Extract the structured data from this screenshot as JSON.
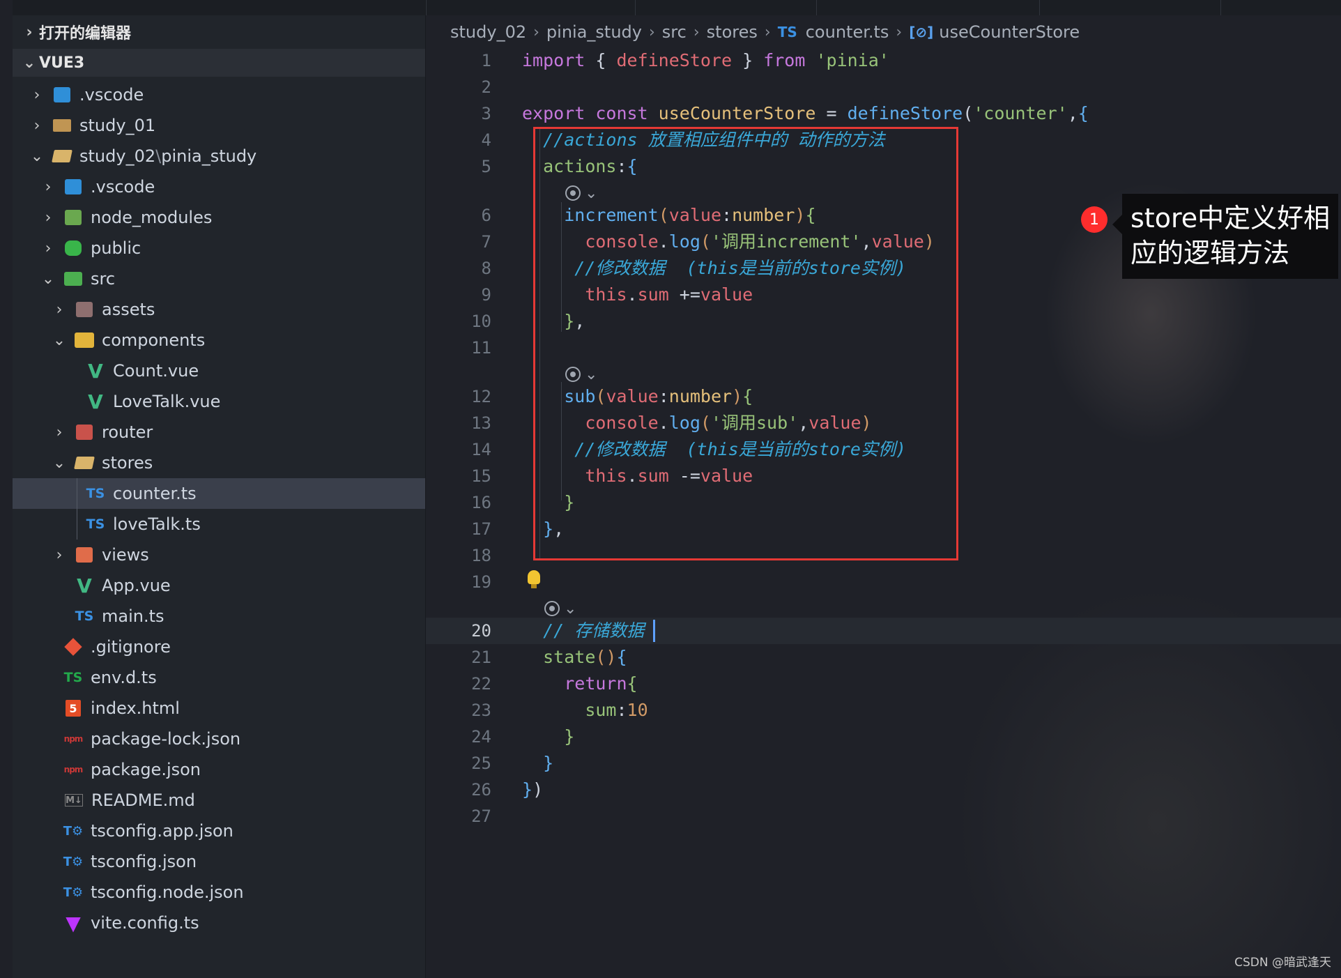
{
  "explorer": {
    "open_editors_label": "打开的编辑器",
    "workspace_label": "VUE3",
    "tree": [
      {
        "label": ".vscode",
        "icon": "vscode-folder-icon",
        "indent": 0,
        "chevron": "›"
      },
      {
        "label": "study_01",
        "icon": "folder-icon",
        "indent": 0,
        "chevron": "›"
      },
      {
        "label": "study_02",
        "label2": "pinia_study",
        "icon": "folder-open-icon",
        "indent": 0,
        "chevron": "⌄"
      },
      {
        "label": ".vscode",
        "icon": "vscode-folder-icon",
        "indent": 1,
        "chevron": "›"
      },
      {
        "label": "node_modules",
        "icon": "node-folder-icon",
        "indent": 1,
        "chevron": "›"
      },
      {
        "label": "public",
        "icon": "public-folder-icon",
        "indent": 1,
        "chevron": "›"
      },
      {
        "label": "src",
        "icon": "src-folder-icon",
        "indent": 1,
        "chevron": "⌄"
      },
      {
        "label": "assets",
        "icon": "assets-folder-icon",
        "indent": 2,
        "chevron": "›"
      },
      {
        "label": "components",
        "icon": "components-folder-icon",
        "indent": 2,
        "chevron": "⌄"
      },
      {
        "label": "Count.vue",
        "icon": "vue-file-icon",
        "indent": 3,
        "chevron": ""
      },
      {
        "label": "LoveTalk.vue",
        "icon": "vue-file-icon",
        "indent": 3,
        "chevron": ""
      },
      {
        "label": "router",
        "icon": "router-folder-icon",
        "indent": 2,
        "chevron": "›"
      },
      {
        "label": "stores",
        "icon": "folder-open-icon",
        "indent": 2,
        "chevron": "⌄"
      },
      {
        "label": "counter.ts",
        "icon": "typescript-file-icon",
        "indent": 3,
        "chevron": "",
        "selected": true
      },
      {
        "label": "loveTalk.ts",
        "icon": "typescript-file-icon",
        "indent": 3,
        "chevron": ""
      },
      {
        "label": "views",
        "icon": "views-folder-icon",
        "indent": 2,
        "chevron": "›"
      },
      {
        "label": "App.vue",
        "icon": "vue-file-icon",
        "indent": 2,
        "chevron": ""
      },
      {
        "label": "main.ts",
        "icon": "typescript-file-icon",
        "indent": 2,
        "chevron": ""
      },
      {
        "label": ".gitignore",
        "icon": "git-file-icon",
        "indent": 1,
        "chevron": ""
      },
      {
        "label": "env.d.ts",
        "icon": "typescript-def-file-icon",
        "indent": 1,
        "chevron": ""
      },
      {
        "label": "index.html",
        "icon": "html-file-icon",
        "indent": 1,
        "chevron": ""
      },
      {
        "label": "package-lock.json",
        "icon": "npm-file-icon",
        "indent": 1,
        "chevron": ""
      },
      {
        "label": "package.json",
        "icon": "npm-file-icon",
        "indent": 1,
        "chevron": ""
      },
      {
        "label": "README.md",
        "icon": "markdown-file-icon",
        "indent": 1,
        "chevron": ""
      },
      {
        "label": "tsconfig.app.json",
        "icon": "tsconfig-file-icon",
        "indent": 1,
        "chevron": ""
      },
      {
        "label": "tsconfig.json",
        "icon": "tsconfig-file-icon",
        "indent": 1,
        "chevron": ""
      },
      {
        "label": "tsconfig.node.json",
        "icon": "tsconfig-file-icon",
        "indent": 1,
        "chevron": ""
      },
      {
        "label": "vite.config.ts",
        "icon": "vite-file-icon",
        "indent": 1,
        "chevron": ""
      }
    ]
  },
  "breadcrumb": {
    "items": [
      "study_02",
      "pinia_study",
      "src",
      "stores"
    ],
    "file_badge": "TS",
    "file": "counter.ts",
    "symbol_icon": "[⊘]",
    "symbol": "useCounterStore"
  },
  "code": {
    "lines": [
      {
        "n": "1",
        "tokens": [
          [
            "k",
            "import "
          ],
          [
            "p",
            "{ "
          ],
          [
            "v",
            "defineStore"
          ],
          [
            "p",
            " } "
          ],
          [
            "k",
            "from "
          ],
          [
            "s",
            "'pinia'"
          ]
        ]
      },
      {
        "n": "2",
        "tokens": []
      },
      {
        "n": "3",
        "tokens": [
          [
            "k",
            "export "
          ],
          [
            "k",
            "const "
          ],
          [
            "fn",
            "useCounterStore"
          ],
          [
            "p",
            " = "
          ],
          [
            "f",
            "defineStore"
          ],
          [
            "p",
            "("
          ],
          [
            "s",
            "'counter'"
          ],
          [
            "p",
            ","
          ],
          [
            "b2",
            "{"
          ]
        ]
      },
      {
        "n": "4",
        "tokens": [
          [
            "c",
            "  //actions 放置相应组件中的 动作的方法"
          ]
        ]
      },
      {
        "n": "5",
        "tokens": [
          [
            "p",
            "  "
          ],
          [
            "s",
            "actions"
          ],
          [
            "p",
            ":"
          ],
          [
            "b2",
            "{"
          ]
        ]
      },
      {
        "lens": true
      },
      {
        "n": "6",
        "tokens": [
          [
            "p",
            "    "
          ],
          [
            "f",
            "increment"
          ],
          [
            "b1",
            "("
          ],
          [
            "v",
            "value"
          ],
          [
            "p",
            ":"
          ],
          [
            "t",
            "number"
          ],
          [
            "b1",
            ")"
          ],
          [
            "b3",
            "{"
          ]
        ]
      },
      {
        "n": "7",
        "tokens": [
          [
            "p",
            "      "
          ],
          [
            "v",
            "console"
          ],
          [
            "p",
            "."
          ],
          [
            "f",
            "log"
          ],
          [
            "b1",
            "("
          ],
          [
            "s",
            "'调用increment'"
          ],
          [
            "p",
            ","
          ],
          [
            "v",
            "value"
          ],
          [
            "b1",
            ")"
          ]
        ]
      },
      {
        "n": "8",
        "tokens": [
          [
            "c",
            "     //修改数据  (this是当前的store实例)"
          ]
        ]
      },
      {
        "n": "9",
        "tokens": [
          [
            "p",
            "      "
          ],
          [
            "v",
            "this"
          ],
          [
            "p",
            "."
          ],
          [
            "v",
            "sum"
          ],
          [
            "p",
            " +="
          ],
          [
            "v",
            "value"
          ]
        ]
      },
      {
        "n": "10",
        "tokens": [
          [
            "p",
            "    "
          ],
          [
            "b3",
            "}"
          ],
          [
            "p",
            ","
          ]
        ]
      },
      {
        "n": "11",
        "tokens": []
      },
      {
        "lens": true
      },
      {
        "n": "12",
        "tokens": [
          [
            "p",
            "    "
          ],
          [
            "f",
            "sub"
          ],
          [
            "b1",
            "("
          ],
          [
            "v",
            "value"
          ],
          [
            "p",
            ":"
          ],
          [
            "t",
            "number"
          ],
          [
            "b1",
            ")"
          ],
          [
            "b3",
            "{"
          ]
        ]
      },
      {
        "n": "13",
        "tokens": [
          [
            "p",
            "      "
          ],
          [
            "v",
            "console"
          ],
          [
            "p",
            "."
          ],
          [
            "f",
            "log"
          ],
          [
            "b1",
            "("
          ],
          [
            "s",
            "'调用sub'"
          ],
          [
            "p",
            ","
          ],
          [
            "v",
            "value"
          ],
          [
            "b1",
            ")"
          ]
        ]
      },
      {
        "n": "14",
        "tokens": [
          [
            "c",
            "     //修改数据  (this是当前的store实例)"
          ]
        ]
      },
      {
        "n": "15",
        "tokens": [
          [
            "p",
            "      "
          ],
          [
            "v",
            "this"
          ],
          [
            "p",
            "."
          ],
          [
            "v",
            "sum"
          ],
          [
            "p",
            " -="
          ],
          [
            "v",
            "value"
          ]
        ]
      },
      {
        "n": "16",
        "tokens": [
          [
            "p",
            "    "
          ],
          [
            "b3",
            "}"
          ]
        ]
      },
      {
        "n": "17",
        "tokens": [
          [
            "p",
            "  "
          ],
          [
            "b2",
            "}"
          ],
          [
            "p",
            ","
          ]
        ]
      },
      {
        "n": "18",
        "tokens": []
      },
      {
        "n": "19",
        "tokens": []
      },
      {
        "lens": true
      },
      {
        "n": "20",
        "tokens": [
          [
            "c",
            "  // 存储数据"
          ]
        ],
        "current": true
      },
      {
        "n": "21",
        "tokens": [
          [
            "p",
            "  "
          ],
          [
            "s",
            "state"
          ],
          [
            "b1",
            "()"
          ],
          [
            "b2",
            "{"
          ]
        ]
      },
      {
        "n": "22",
        "tokens": [
          [
            "p",
            "    "
          ],
          [
            "k",
            "return"
          ],
          [
            "b3",
            "{"
          ]
        ]
      },
      {
        "n": "23",
        "tokens": [
          [
            "p",
            "      "
          ],
          [
            "s",
            "sum"
          ],
          [
            "p",
            ":"
          ],
          [
            "n",
            "10"
          ]
        ]
      },
      {
        "n": "24",
        "tokens": [
          [
            "p",
            "    "
          ],
          [
            "b3",
            "}"
          ]
        ]
      },
      {
        "n": "25",
        "tokens": [
          [
            "p",
            "  "
          ],
          [
            "b2",
            "}"
          ]
        ]
      },
      {
        "n": "26",
        "tokens": [
          [
            "b2",
            "}"
          ],
          [
            "p",
            ")"
          ]
        ]
      },
      {
        "n": "27",
        "tokens": []
      }
    ]
  },
  "annotation": {
    "badge": "1",
    "text_line1": "store中定义好相",
    "text_line2": "应的逻辑方法"
  },
  "watermark": "CSDN @暗武逢天",
  "colors": {
    "highlight_box": "#e53935",
    "badge": "#ff2d2d",
    "comment": "#3aa8d8"
  }
}
